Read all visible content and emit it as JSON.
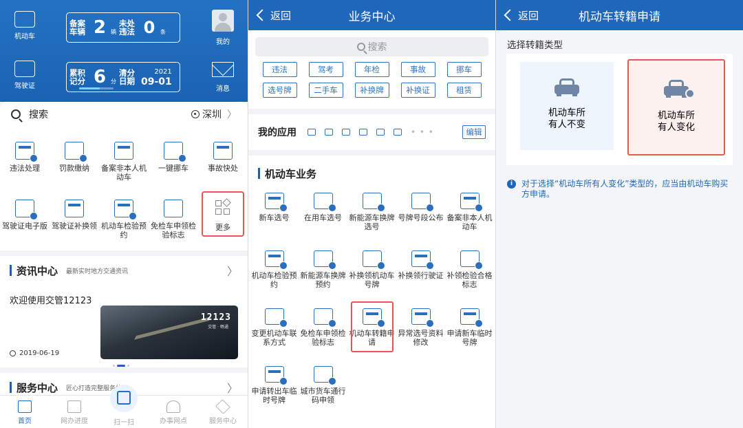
{
  "screen1": {
    "vehicle_label": "机动车",
    "license_label": "驾驶证",
    "user_label": "我的",
    "message_label": "消息",
    "card1": {
      "label1": "备案车辆",
      "value1": "2",
      "unit1": "辆",
      "label2": "未处违法",
      "value2": "0",
      "unit2": "条"
    },
    "card2": {
      "label1": "累积记分",
      "value1": "6",
      "unit1": "分",
      "label2": "清分日期",
      "year": "2021",
      "date": "09-01"
    },
    "search_label": "搜索",
    "city": "深圳",
    "services": [
      {
        "label": "违法处理"
      },
      {
        "label": "罚款缴纳"
      },
      {
        "label": "备案非本人机动车"
      },
      {
        "label": "一键挪车"
      },
      {
        "label": "事故快处"
      },
      {
        "label": "驾驶证电子版"
      },
      {
        "label": "驾驶证补换领"
      },
      {
        "label": "机动车检验预约"
      },
      {
        "label": "免检车申领检验标志"
      },
      {
        "label": "更多"
      }
    ],
    "news": {
      "title": "资讯中心",
      "subtitle": "最新实时地方交通资讯",
      "headline": "欢迎使用交管12123",
      "date": "2019-06-19",
      "image_brand": "12123",
      "image_brand_sub": "交管 · 畅通"
    },
    "service_center": {
      "title": "服务中心",
      "subtitle": "匠心打造完整服务体系"
    },
    "tabs": [
      {
        "label": "首页",
        "icon": "home-icon"
      },
      {
        "label": "网办进度",
        "icon": "monitor-icon"
      },
      {
        "label": "扫一扫",
        "icon": "scan-icon"
      },
      {
        "label": "办事网点",
        "icon": "location-icon"
      },
      {
        "label": "服务中心",
        "icon": "diamond-icon"
      }
    ]
  },
  "screen2": {
    "back_label": "返回",
    "title": "业务中心",
    "search_placeholder": "搜索",
    "tags": [
      "违法",
      "驾考",
      "年检",
      "事故",
      "挪车",
      "选号牌",
      "二手车",
      "补换牌",
      "补换证",
      "租赁"
    ],
    "my_apps_label": "我的应用",
    "edit_label": "编辑",
    "section_title": "机动车业务",
    "items": [
      {
        "label": "新车选号"
      },
      {
        "label": "在用车选号"
      },
      {
        "label": "新能源车换牌选号"
      },
      {
        "label": "号牌号段公布"
      },
      {
        "label": "备案非本人机动车"
      },
      {
        "label": "机动车检验预约"
      },
      {
        "label": "新能源车换牌预约"
      },
      {
        "label": "补换领机动车号牌"
      },
      {
        "label": "补换领行驶证"
      },
      {
        "label": "补领检验合格标志"
      },
      {
        "label": "变更机动车联系方式"
      },
      {
        "label": "免检车申领检验标志"
      },
      {
        "label": "机动车转籍申请"
      },
      {
        "label": "异常选号资料修改"
      },
      {
        "label": "申请新车临时号牌"
      },
      {
        "label": "申请转出车临时号牌"
      },
      {
        "label": "城市货车通行码申领"
      }
    ]
  },
  "screen3": {
    "back_label": "返回",
    "title": "机动车转籍申请",
    "select_label": "选择转籍类型",
    "option_left": "机动车所有人不变",
    "option_right": "机动车所有人变化",
    "note": "对于选择“机动车所有人变化”类型的，应当由机动车购买方申请。"
  },
  "colors": {
    "primary": "#1f67bb",
    "highlight": "#e05a4f",
    "icon": "#2a6fbd"
  }
}
